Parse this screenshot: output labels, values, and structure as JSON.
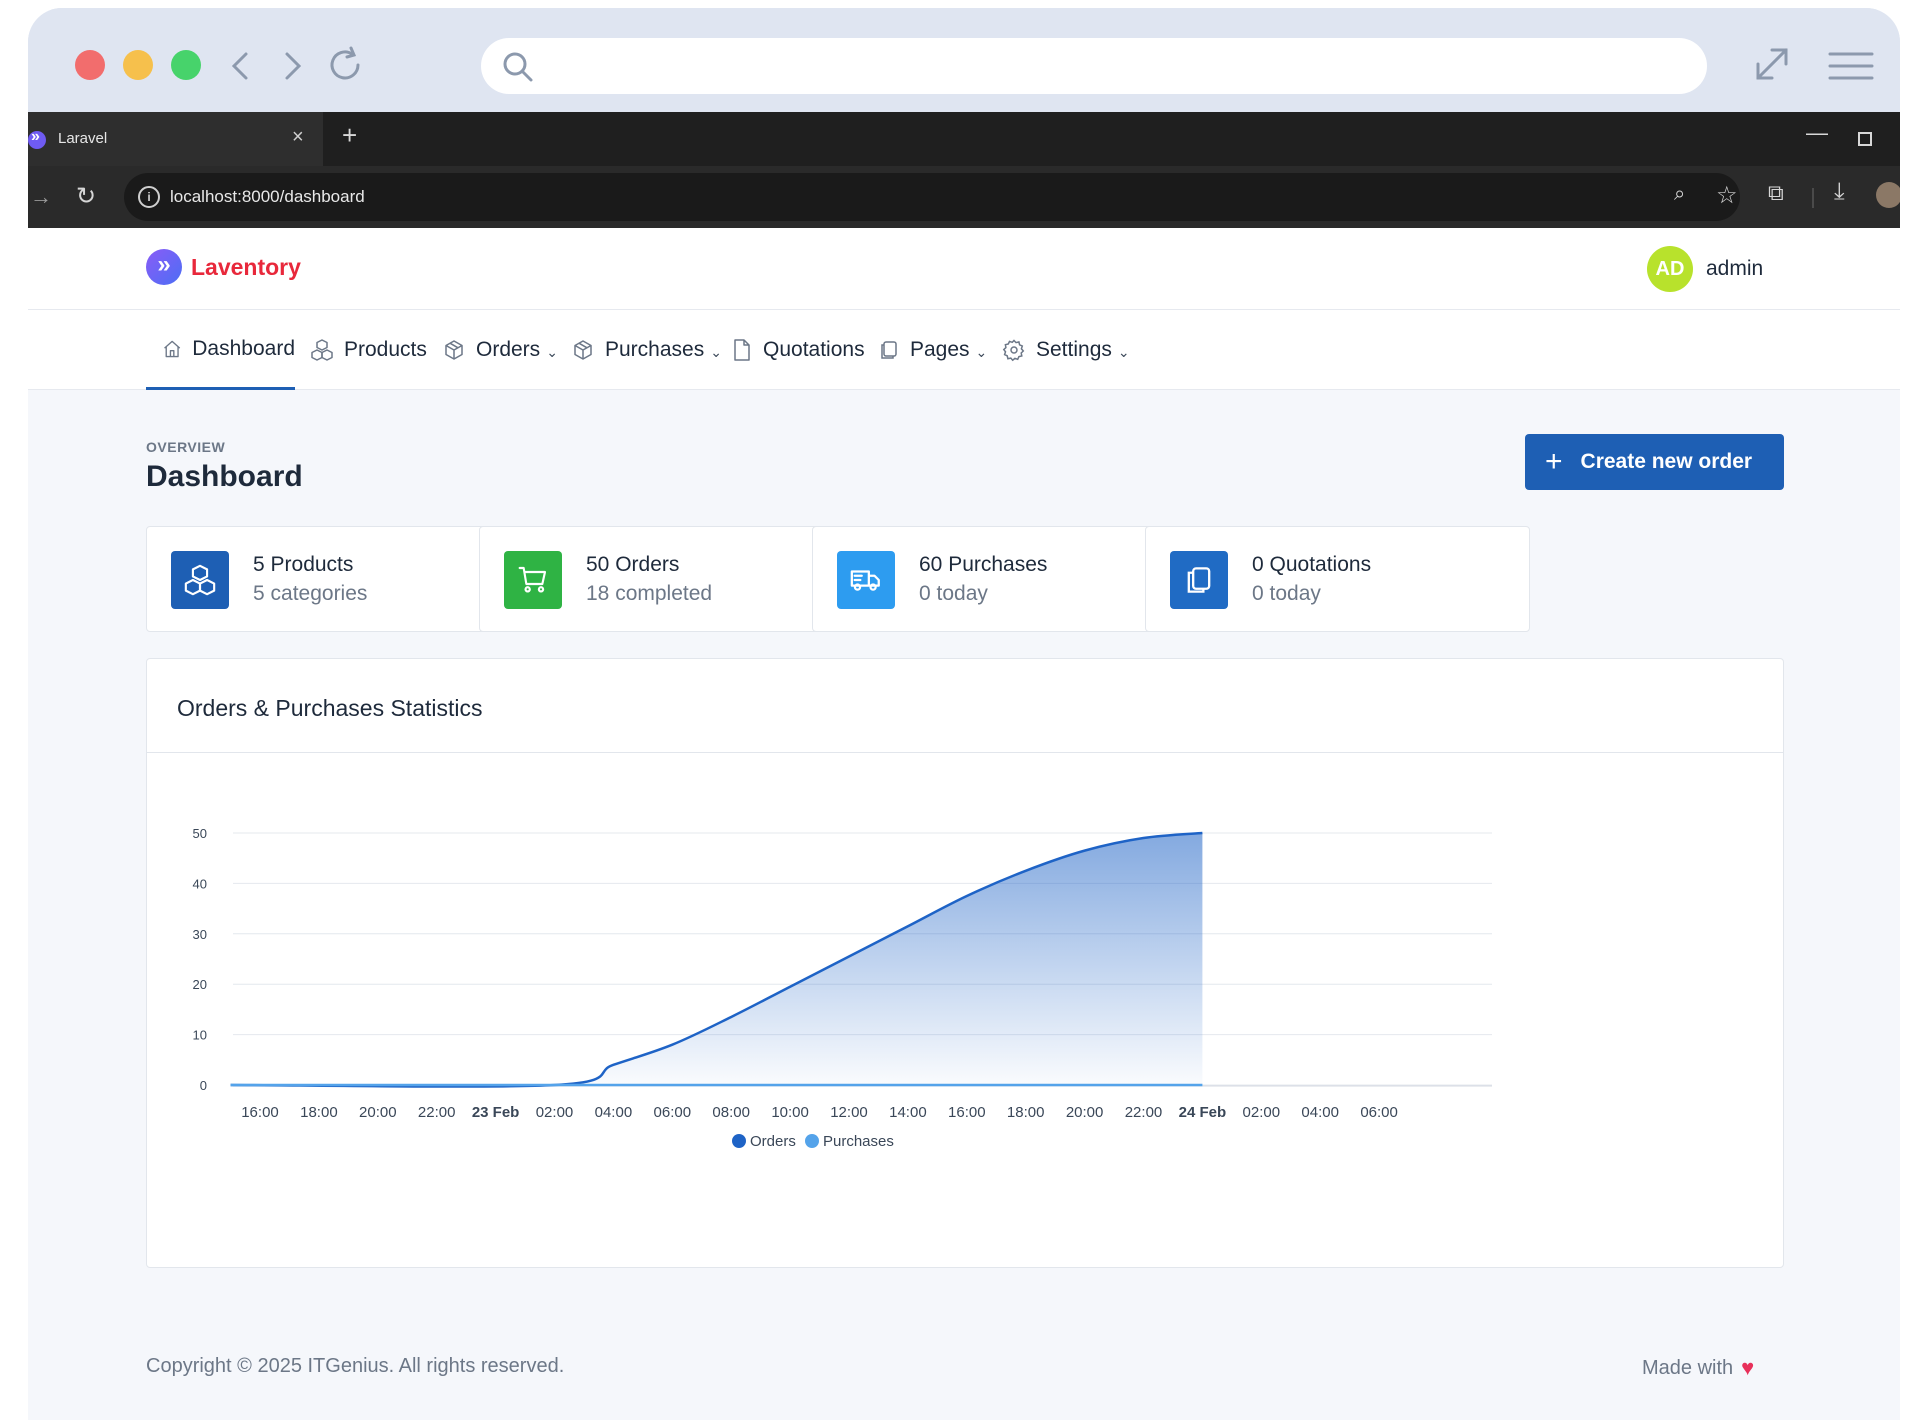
{
  "browser": {
    "tab_title": "Laravel",
    "tab_close": "×",
    "new_tab": "+",
    "url": "localhost:8000/dashboard"
  },
  "brand": {
    "logo_glyph": "»",
    "name": "Laventory",
    "color": "#e8283b"
  },
  "user": {
    "initials": "AD",
    "name": "admin",
    "avatar_color": "#b8e22c"
  },
  "nav": [
    {
      "label": "Dashboard",
      "icon": "home-icon",
      "dropdown": false,
      "active": true
    },
    {
      "label": "Products",
      "icon": "boxes-icon",
      "dropdown": false
    },
    {
      "label": "Orders",
      "icon": "package-icon",
      "dropdown": true
    },
    {
      "label": "Purchases",
      "icon": "package-icon",
      "dropdown": true
    },
    {
      "label": "Quotations",
      "icon": "file-icon",
      "dropdown": false
    },
    {
      "label": "Pages",
      "icon": "copy-icon",
      "dropdown": true
    },
    {
      "label": "Settings",
      "icon": "gear-icon",
      "dropdown": true
    }
  ],
  "header": {
    "pretitle": "OVERVIEW",
    "title": "Dashboard",
    "create_button": "Create new order",
    "create_icon": "+"
  },
  "cards": [
    {
      "line1": "5 Products",
      "line2": "5 categories",
      "icon": "boxes-icon",
      "color": "#1e5fb4"
    },
    {
      "line1": "50 Orders",
      "line2": "18 completed",
      "icon": "cart-icon",
      "color": "#2fb344"
    },
    {
      "line1": "60 Purchases",
      "line2": "0 today",
      "icon": "truck-icon",
      "color": "#2d9cf0"
    },
    {
      "line1": "0 Quotations",
      "line2": "0 today",
      "icon": "copy-icon",
      "color": "#206bc4"
    }
  ],
  "stats": {
    "title": "Orders & Purchases Statistics"
  },
  "chart_data": {
    "type": "area",
    "x_ticks": [
      "16:00",
      "18:00",
      "20:00",
      "22:00",
      "23 Feb",
      "02:00",
      "04:00",
      "06:00",
      "08:00",
      "10:00",
      "12:00",
      "14:00",
      "16:00",
      "18:00",
      "20:00",
      "22:00",
      "24 Feb",
      "02:00",
      "04:00",
      "06:00"
    ],
    "x_ticks_bold": [
      "23 Feb",
      "24 Feb"
    ],
    "y_ticks": [
      "0",
      "10",
      "20",
      "30",
      "40",
      "50"
    ],
    "ylim": [
      0,
      50
    ],
    "grid": true,
    "legend": "bottom-center",
    "series": [
      {
        "name": "Orders",
        "color": "#1e63c6",
        "points": [
          [
            "15:00",
            0
          ],
          [
            "23 Feb 02:00",
            0
          ],
          [
            "04:00",
            4
          ],
          [
            "06:00",
            8
          ],
          [
            "08:00",
            13.5
          ],
          [
            "10:00",
            19.5
          ],
          [
            "12:00",
            25.5
          ],
          [
            "14:00",
            31.5
          ],
          [
            "16:00",
            37.5
          ],
          [
            "18:00",
            42.5
          ],
          [
            "20:00",
            46.5
          ],
          [
            "22:00",
            49
          ],
          [
            "24 Feb",
            50
          ]
        ]
      },
      {
        "name": "Purchases",
        "color": "#54a3ea",
        "points": [
          [
            "15:00",
            0
          ],
          [
            "24 Feb",
            0
          ]
        ]
      }
    ]
  },
  "footer": {
    "copyright": "Copyright © 2025 ITGenius. All rights reserved.",
    "made_with": "Made with",
    "heart": "♥"
  }
}
